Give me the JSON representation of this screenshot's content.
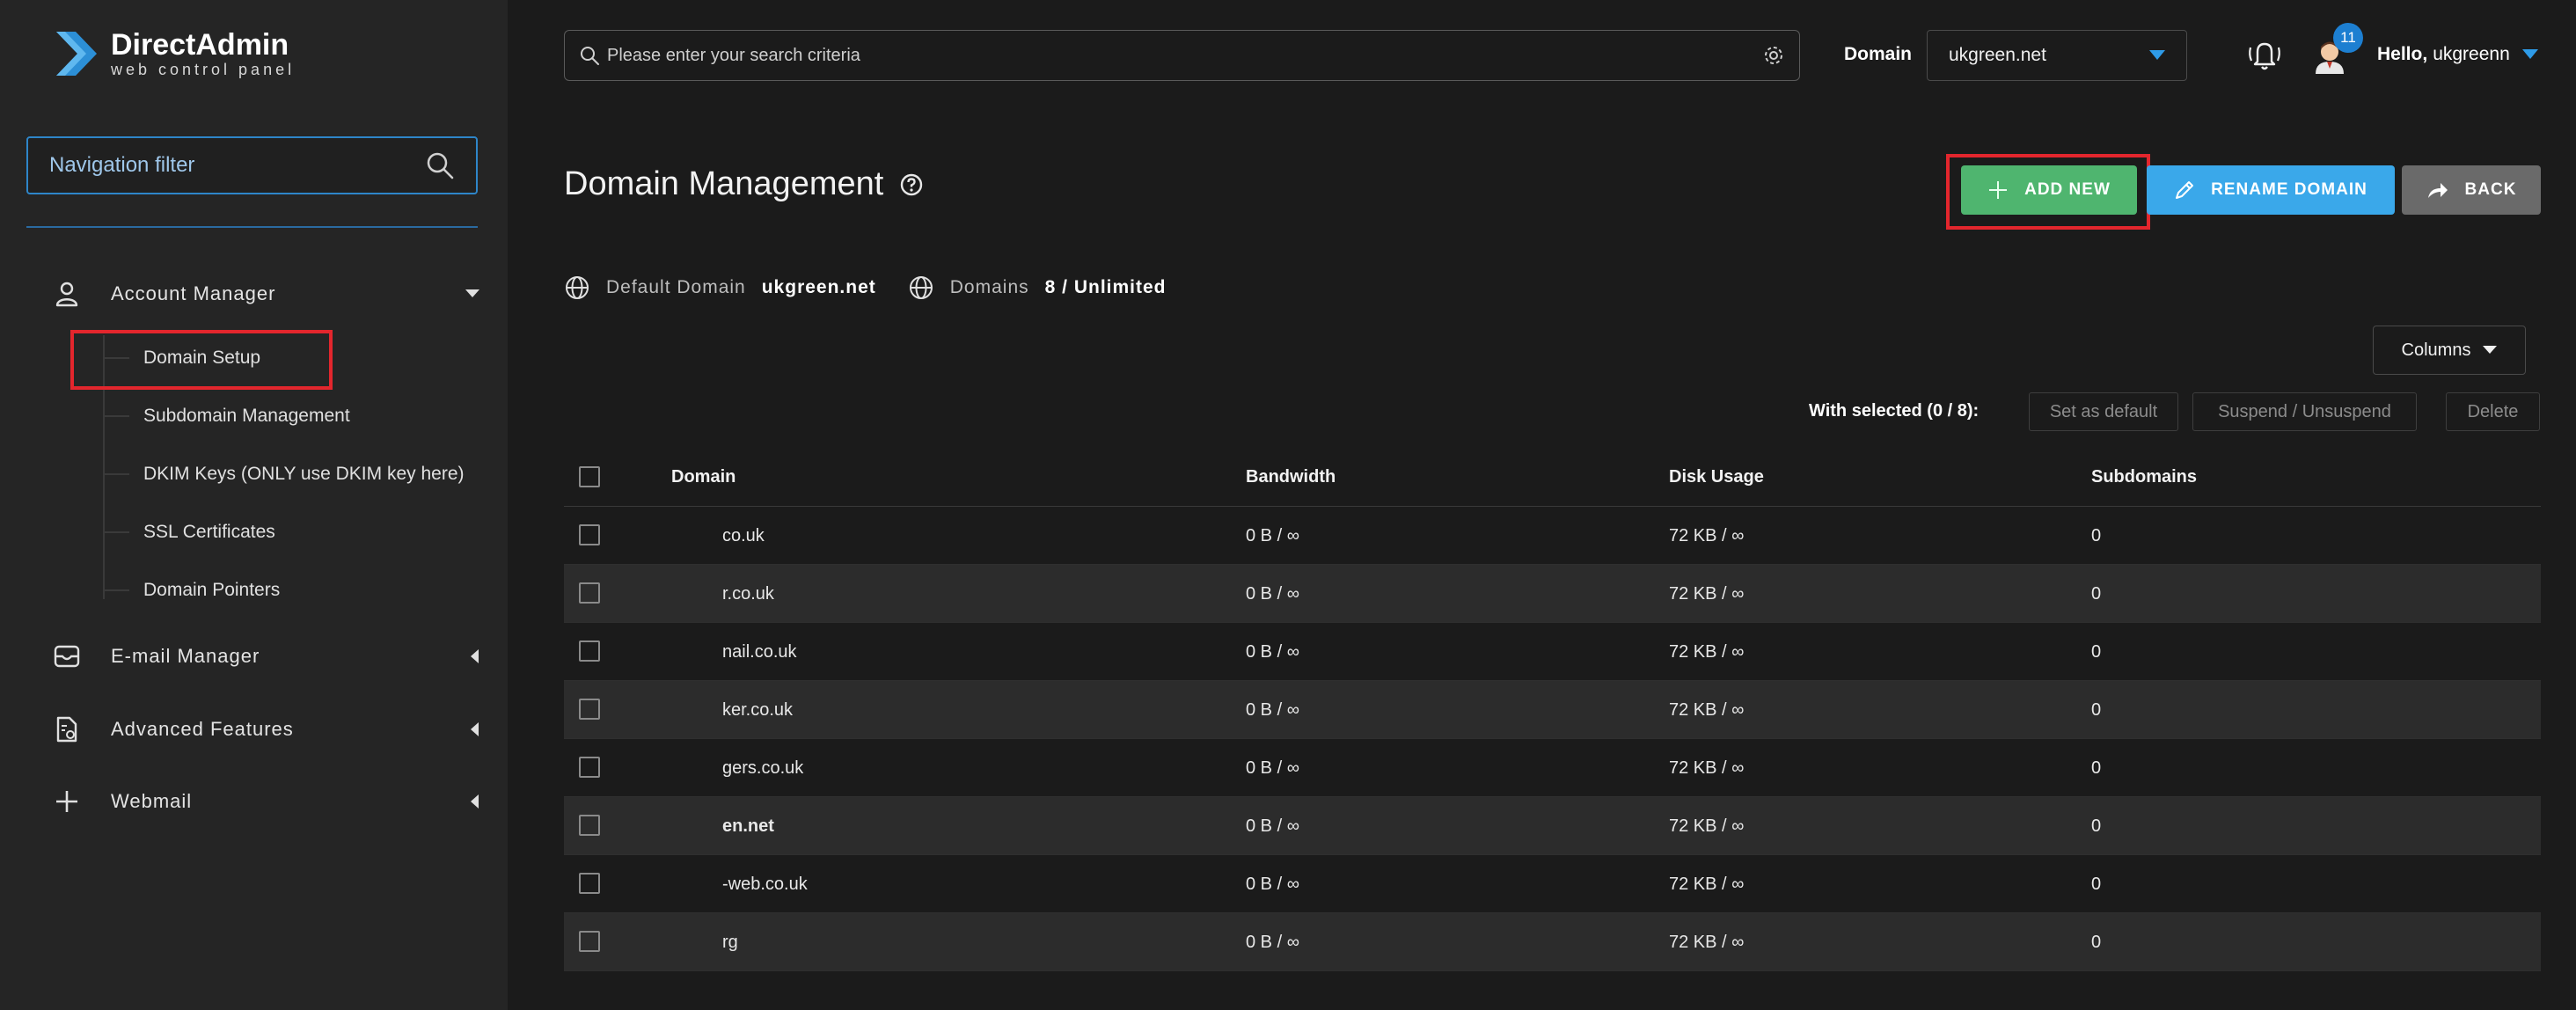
{
  "sidebar": {
    "logo": {
      "name": "DirectAdmin",
      "tagline": "web control panel"
    },
    "nav_filter_placeholder": "Navigation filter",
    "sections": [
      {
        "label": "Account Manager",
        "icon": "user-icon",
        "expanded": true
      },
      {
        "label": "E-mail Manager",
        "icon": "mail-icon",
        "expanded": false
      },
      {
        "label": "Advanced Features",
        "icon": "advanced-file-icon",
        "expanded": false
      },
      {
        "label": "Webmail",
        "icon": "plus-icon",
        "expanded": false
      }
    ],
    "account_manager_items": [
      {
        "label": "Domain Setup",
        "highlighted": true
      },
      {
        "label": "Subdomain Management"
      },
      {
        "label": "DKIM Keys (ONLY use DKIM key here)"
      },
      {
        "label": "SSL Certificates"
      },
      {
        "label": "Domain Pointers"
      }
    ]
  },
  "topbar": {
    "search_placeholder": "Please enter your search criteria",
    "domain_label": "Domain",
    "domain_value": "ukgreen.net",
    "notification_count": "11",
    "hello_prefix": "Hello,",
    "username": "ukgreenn"
  },
  "page": {
    "title": "Domain Management",
    "buttons": {
      "add_new": "ADD NEW",
      "rename_domain": "RENAME DOMAIN",
      "back": "BACK"
    },
    "info": {
      "default_domain_label": "Default Domain",
      "default_domain_value": "ukgreen.net",
      "domains_label": "Domains",
      "domains_value": "8 / Unlimited"
    },
    "columns_button": "Columns",
    "with_selected": "With selected (0 / 8):",
    "bulk_actions": [
      "Set as default",
      "Suspend / Unsuspend",
      "Delete"
    ]
  },
  "table": {
    "headers": [
      "Domain",
      "Bandwidth",
      "Disk Usage",
      "Subdomains"
    ],
    "rows": [
      {
        "domain": "co.uk",
        "bandwidth": "0 B / ∞",
        "disk": "72 KB / ∞",
        "subdomains": "0",
        "bold": false
      },
      {
        "domain": "r.co.uk",
        "bandwidth": "0 B / ∞",
        "disk": "72 KB / ∞",
        "subdomains": "0",
        "bold": false
      },
      {
        "domain": "nail.co.uk",
        "bandwidth": "0 B / ∞",
        "disk": "72 KB / ∞",
        "subdomains": "0",
        "bold": false
      },
      {
        "domain": "ker.co.uk",
        "bandwidth": "0 B / ∞",
        "disk": "72 KB / ∞",
        "subdomains": "0",
        "bold": false
      },
      {
        "domain": "gers.co.uk",
        "bandwidth": "0 B / ∞",
        "disk": "72 KB / ∞",
        "subdomains": "0",
        "bold": false
      },
      {
        "domain": "en.net",
        "bandwidth": "0 B / ∞",
        "disk": "72 KB / ∞",
        "subdomains": "0",
        "bold": true
      },
      {
        "domain": "-web.co.uk",
        "bandwidth": "0 B / ∞",
        "disk": "72 KB / ∞",
        "subdomains": "0",
        "bold": false
      },
      {
        "domain": "rg",
        "bandwidth": "0 B / ∞",
        "disk": "72 KB / ∞",
        "subdomains": "0",
        "bold": false
      }
    ]
  },
  "colors": {
    "sidebar_bg": "#252525",
    "main_bg": "#1b1b1b",
    "accent_blue": "#2e86c9",
    "add_green": "#4fb56f",
    "rename_blue": "#3aa8ea",
    "back_gray": "#6a6a6a",
    "highlight_red": "#e3262d"
  }
}
